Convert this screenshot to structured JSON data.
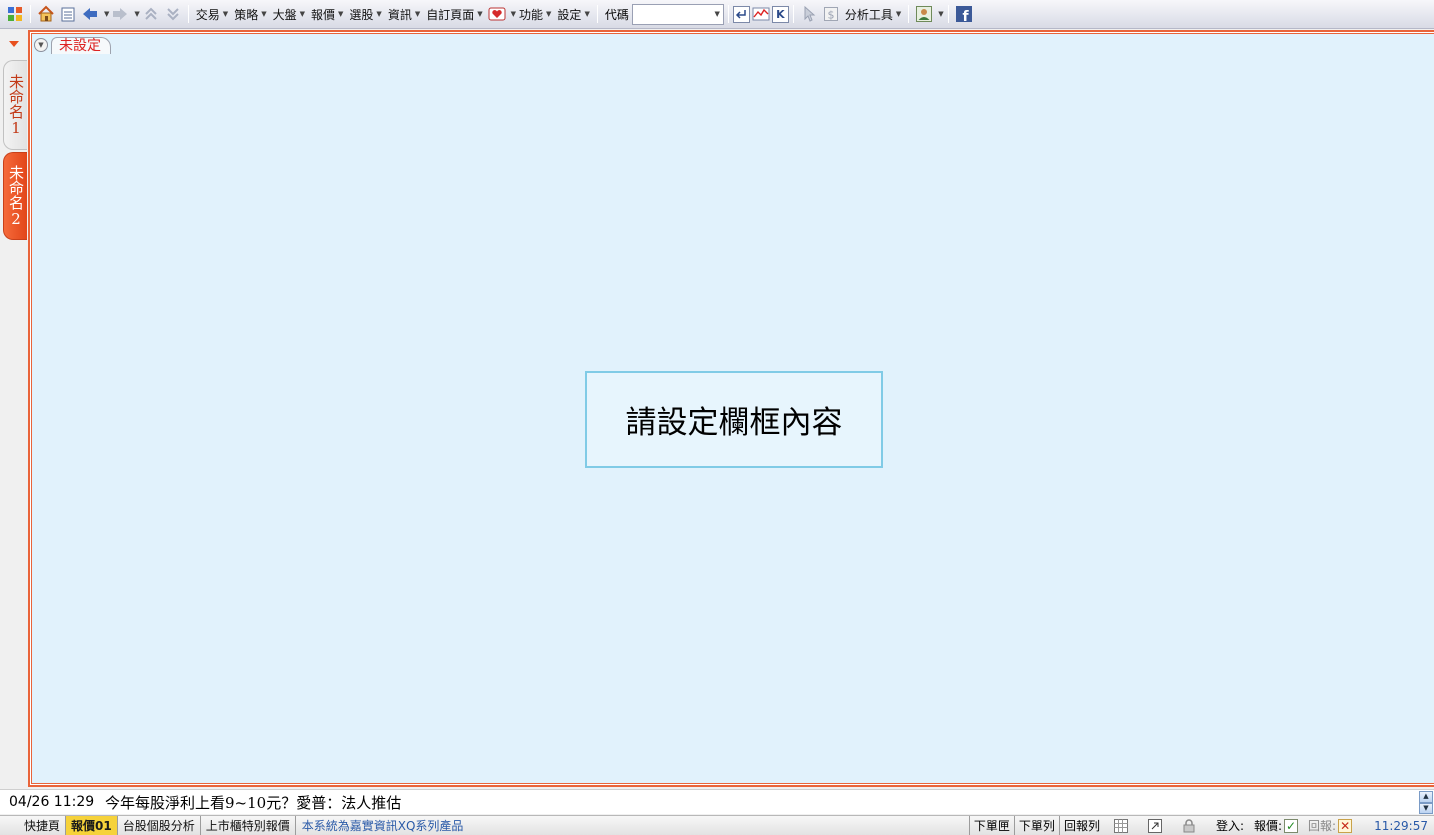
{
  "toolbar": {
    "menus": [
      {
        "label": "交易"
      },
      {
        "label": "策略"
      },
      {
        "label": "大盤"
      },
      {
        "label": "報價"
      },
      {
        "label": "選股"
      },
      {
        "label": "資訊"
      },
      {
        "label": "自訂頁面"
      }
    ],
    "menus2": [
      {
        "label": "功能"
      },
      {
        "label": "設定"
      }
    ],
    "code_label": "代碼",
    "code_value": "",
    "analysis_tools_label": "分析工具",
    "k_button_label": "K"
  },
  "left_tabs": [
    {
      "label": "未命名1",
      "active": false
    },
    {
      "label": "未命名2",
      "active": true
    }
  ],
  "main": {
    "subtab_label": "未設定",
    "placeholder_text": "請設定欄框內容"
  },
  "ticker": {
    "time": "04/26 11:29",
    "headline": "今年每股淨利上看9~10元？愛普：法人推估"
  },
  "statusbar": {
    "tabs": [
      {
        "label": "快捷頁",
        "active": false
      },
      {
        "label": "報價01",
        "active": true
      },
      {
        "label": "台股個股分析",
        "active": false
      },
      {
        "label": "上市櫃特別報價",
        "active": false
      }
    ],
    "notice": "本系統為嘉實資訊XQ系列產品",
    "buttons": [
      {
        "label": "下單匣"
      },
      {
        "label": "下單列"
      },
      {
        "label": "回報列"
      }
    ],
    "login_label": "登入:",
    "quote_label": "報價:",
    "report_label": "回報:",
    "time": "11:29:57"
  },
  "colors": {
    "accent": "#e9643a",
    "content_bg": "#e1f2fc",
    "active_tab": "#f6d23a"
  }
}
